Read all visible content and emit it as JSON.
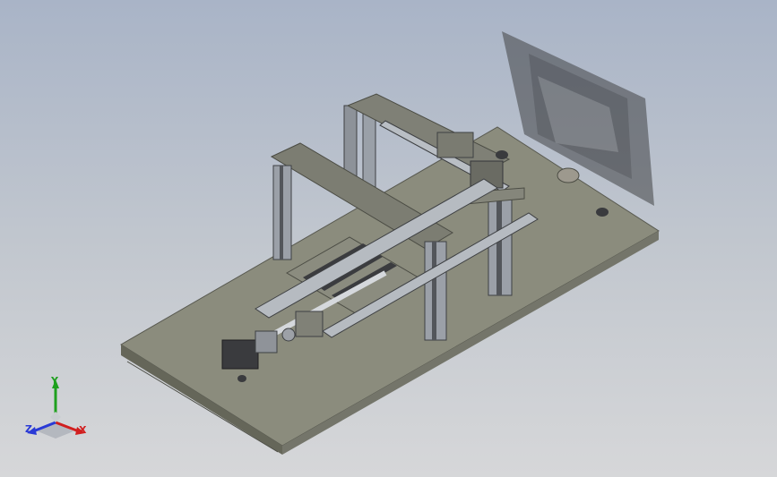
{
  "window": {
    "background": "#b8c0cc"
  },
  "model": {
    "description_icon": "cad-assembly-machine",
    "colors": {
      "plate_top": "#8c8c7e",
      "plate_side": "#6f6f64",
      "frame": "#7d7d73",
      "aluminum": "#9a9fa8",
      "dark": "#3a3b3e",
      "shadow": "#3f4040"
    }
  },
  "triad": {
    "x_label": "X",
    "y_label": "Y",
    "z_label": "Z",
    "x_color": "#d11f1f",
    "y_color": "#1ea01e",
    "z_color": "#2a3ad6"
  }
}
